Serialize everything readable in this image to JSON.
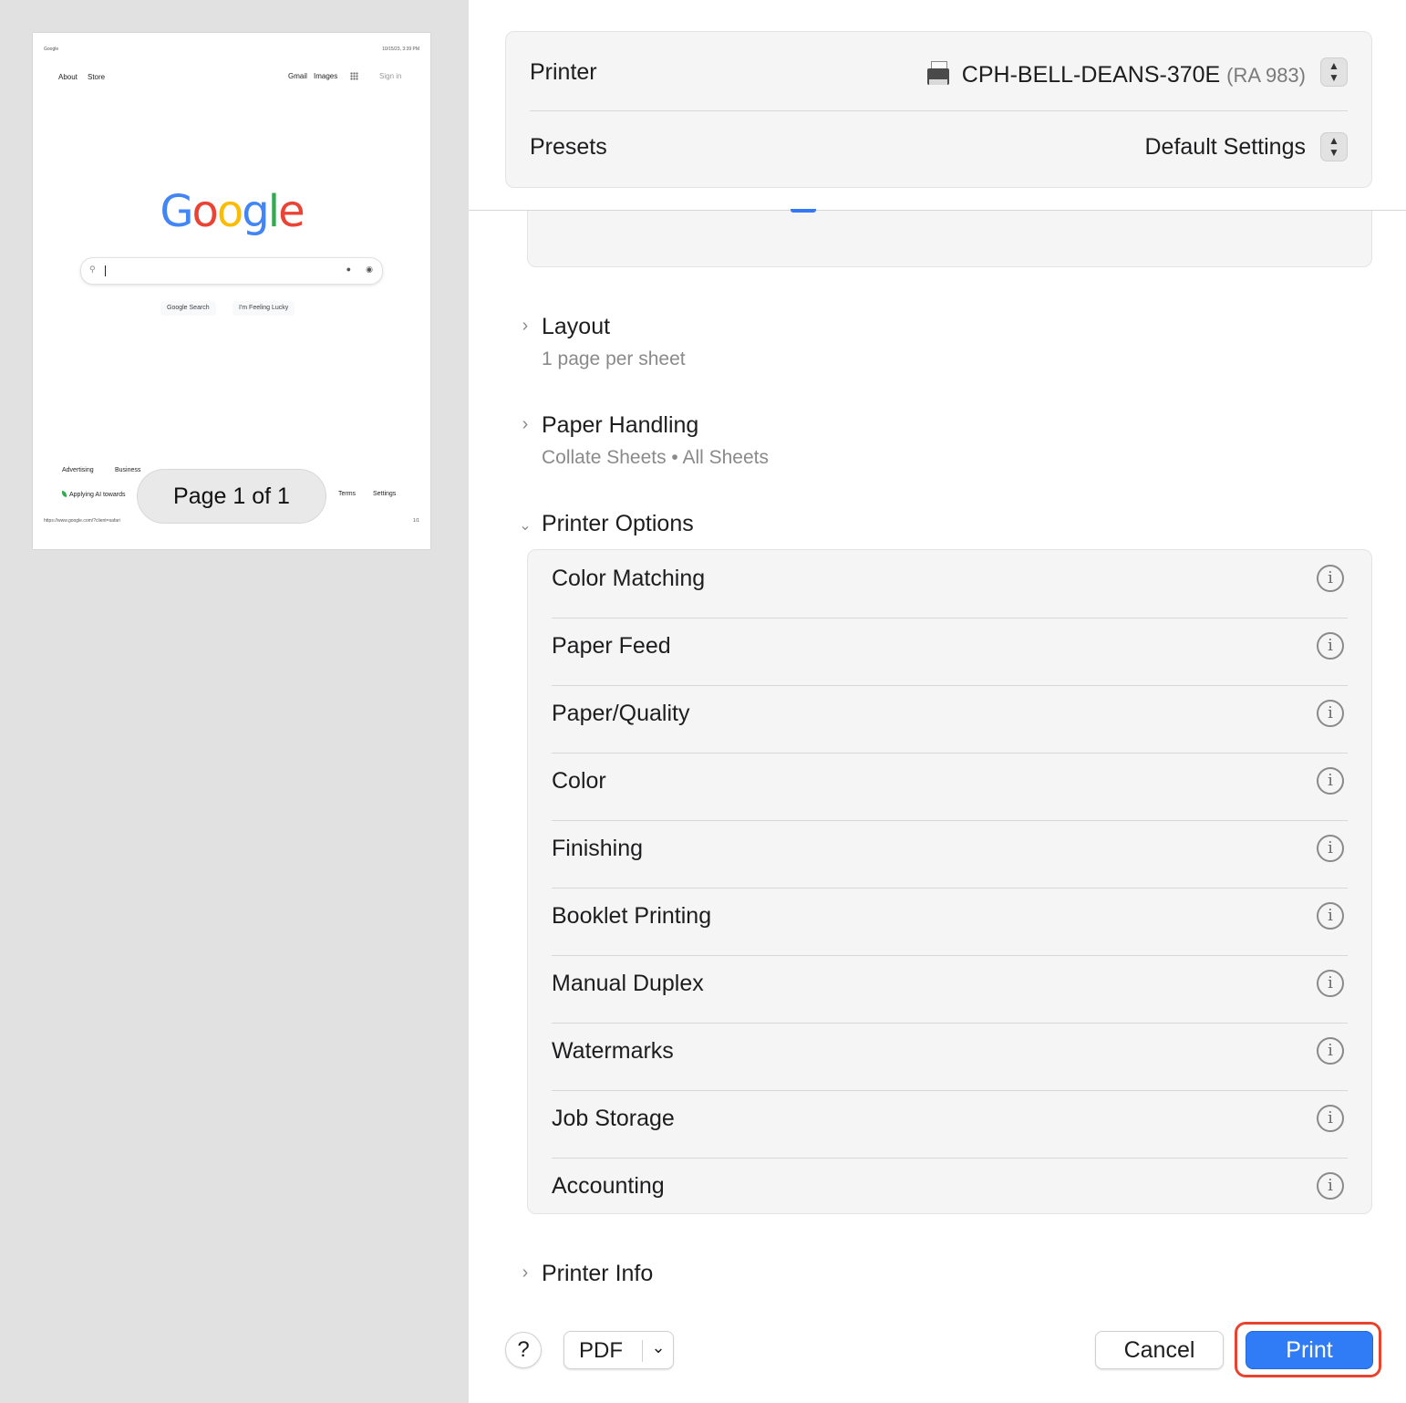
{
  "preview": {
    "page_indicator": "Page 1 of 1",
    "thumbnail": {
      "header_left": "Google",
      "header_right": "10/15/23, 3:39 PM",
      "nav_about": "About",
      "nav_store": "Store",
      "nav_gmail": "Gmail",
      "nav_images": "Images",
      "nav_signin": "Sign in",
      "logo_letters": [
        "G",
        "o",
        "o",
        "g",
        "l",
        "e"
      ],
      "search_button": "Google Search",
      "lucky_button": "I'm Feeling Lucky",
      "footer_advertising": "Advertising",
      "footer_business": "Business",
      "footer_applying_ai": "Applying AI towards",
      "footer_terms": "Terms",
      "footer_settings": "Settings",
      "footer_url": "https://www.google.com/?client=safari",
      "footer_pagenum": "1/1"
    }
  },
  "header": {
    "printer_label": "Printer",
    "printer_name": "CPH-BELL-DEANS-370E",
    "printer_model": "(RA 983)",
    "presets_label": "Presets",
    "presets_value": "Default Settings"
  },
  "sections": {
    "layout_title": "Layout",
    "layout_summary": "1 page per sheet",
    "paper_handling_title": "Paper Handling",
    "paper_handling_summary": "Collate Sheets • All Sheets",
    "printer_options_title": "Printer Options",
    "printer_info_title": "Printer Info"
  },
  "printer_options": [
    "Color Matching",
    "Paper Feed",
    "Paper/Quality",
    "Color",
    "Finishing",
    "Booklet Printing",
    "Manual Duplex",
    "Watermarks",
    "Job Storage",
    "Accounting"
  ],
  "footer": {
    "help_label": "?",
    "pdf_label": "PDF",
    "cancel_label": "Cancel",
    "print_label": "Print"
  },
  "colors": {
    "print_button": "#2f7cf6",
    "focus_ring": "#e8432f",
    "preview_background": "#e1e1e1"
  }
}
